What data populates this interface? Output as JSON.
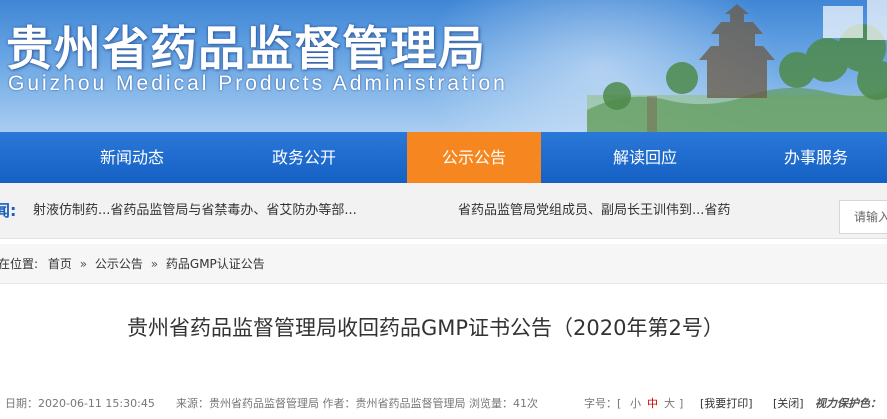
{
  "header": {
    "title_cn": "贵州省药品监督管理局",
    "title_en": "Guizhou Medical Products Administration"
  },
  "nav": {
    "items": [
      "新闻动态",
      "政务公开",
      "公示公告",
      "解读回应",
      "办事服务"
    ],
    "active_index": 2,
    "active_color": "#f6861f"
  },
  "news": {
    "label": "闻:",
    "items": [
      "射液仿制药...省药品监管局与省禁毒办、省艾防办等部...",
      "省药品监管局党组成员、副局长王训伟到...省药"
    ]
  },
  "search": {
    "placeholder": "请输入"
  },
  "breadcrumb": {
    "prefix": "在位置:",
    "items": [
      "首页",
      "公示公告",
      "药品GMP认证公告"
    ],
    "separator": "»"
  },
  "article": {
    "title": "贵州省药品监督管理局收回药品GMP证书公告（2020年第2号）",
    "meta": {
      "date": "日期：2020-06-11 15:30:45",
      "source": "来源：贵州省药品监督管理局 作者：贵州省药品监督管理局 浏览量：41次",
      "font_size_label": "字号：[",
      "font_small": "小",
      "font_medium": "中",
      "font_large": "大",
      "font_close": "]",
      "print_button": "[我要打印]",
      "close_button": "[关闭]",
      "privacy": "视力保护色："
    }
  }
}
